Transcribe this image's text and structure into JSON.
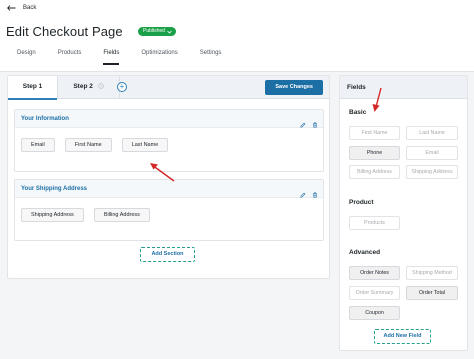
{
  "header": {
    "back_label": "Back",
    "title": "Edit Checkout Page",
    "status_badge": "Published",
    "tabs": [
      {
        "label": "Design"
      },
      {
        "label": "Products"
      },
      {
        "label": "Fields"
      },
      {
        "label": "Optimizations"
      },
      {
        "label": "Settings"
      }
    ],
    "active_tab": "Fields"
  },
  "builder": {
    "steps": [
      {
        "label": "Step 1"
      },
      {
        "label": "Step 2"
      }
    ],
    "add_step_symbol": "+",
    "save_label": "Save Changes",
    "sections": [
      {
        "title": "Your Information",
        "fields": [
          "Email",
          "First Name",
          "Last Name"
        ]
      },
      {
        "title": "Your Shipping Address",
        "fields": [
          "Shipping Address",
          "Billing Address"
        ]
      }
    ],
    "add_section_label": "Add Section"
  },
  "panel": {
    "title": "Fields",
    "basic": {
      "title": "Basic",
      "fields": [
        "First Name",
        "Last Name",
        "Phone",
        "Email",
        "Billing Address",
        "Shipping Address"
      ]
    },
    "product": {
      "title": "Product",
      "fields": [
        "Products"
      ]
    },
    "advanced": {
      "title": "Advanced",
      "fields": [
        "Order Notes",
        "Shipping Method",
        "Order Summary",
        "Order Total",
        "Coupon"
      ]
    },
    "add_field_label": "Add New Field"
  },
  "colors": {
    "accent": "#1c6fa5",
    "badge_green": "#1aa048",
    "dashed_teal": "#239f8c",
    "arrow_red": "#d42828"
  }
}
